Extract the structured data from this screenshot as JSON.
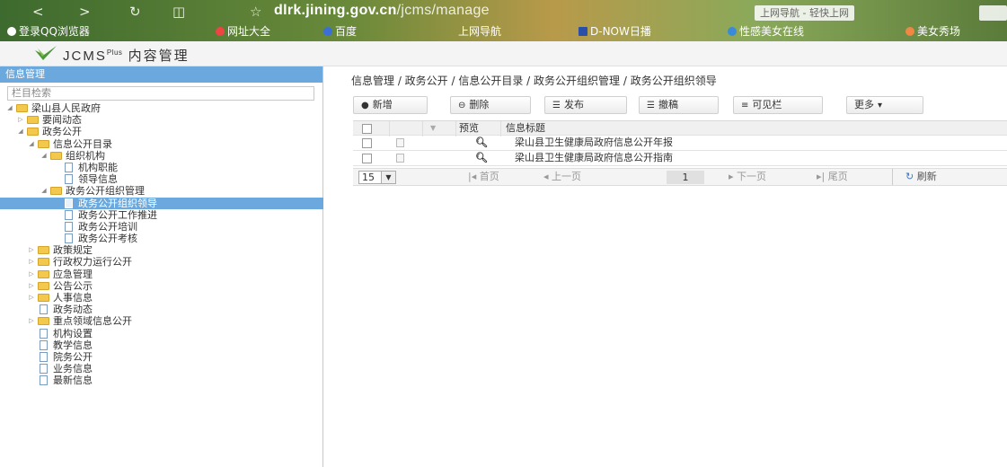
{
  "browser": {
    "url_host": "dlrk.jining.gov.cn",
    "url_path": "/jcms/manage",
    "tab_title": "上网导航 - 轻快上网",
    "bookmarks": [
      "登录QQ浏览器",
      "网址大全",
      "百度",
      "上网导航",
      "D-NOW日播",
      "性感美女在线",
      "美女秀场"
    ]
  },
  "app": {
    "title": "JCMS",
    "title_sup": "Plus",
    "title_suffix": "内容管理"
  },
  "left": {
    "header": "信息管理",
    "search_placeholder": "栏目检索",
    "tree": [
      {
        "label": "梁山县人民政府",
        "depth": 0,
        "kind": "folder",
        "arrow": "open"
      },
      {
        "label": "要闻动态",
        "depth": 1,
        "kind": "folder",
        "arrow": "closed"
      },
      {
        "label": "政务公开",
        "depth": 1,
        "kind": "folder",
        "arrow": "open"
      },
      {
        "label": "信息公开目录",
        "depth": 2,
        "kind": "folder",
        "arrow": "open"
      },
      {
        "label": "组织机构",
        "depth": 3,
        "kind": "folder",
        "arrow": "open"
      },
      {
        "label": "机构职能",
        "depth": 4,
        "kind": "page",
        "arrow": ""
      },
      {
        "label": "领导信息",
        "depth": 4,
        "kind": "page",
        "arrow": ""
      },
      {
        "label": "政务公开组织管理",
        "depth": 3,
        "kind": "folder",
        "arrow": "open"
      },
      {
        "label": "政务公开组织领导",
        "depth": 4,
        "kind": "page",
        "arrow": "",
        "selected": true
      },
      {
        "label": "政务公开工作推进",
        "depth": 4,
        "kind": "page",
        "arrow": ""
      },
      {
        "label": "政务公开培训",
        "depth": 4,
        "kind": "page",
        "arrow": ""
      },
      {
        "label": "政务公开考核",
        "depth": 4,
        "kind": "page",
        "arrow": ""
      },
      {
        "label": "政策规定",
        "depth": 2,
        "kind": "folder",
        "arrow": "closed"
      },
      {
        "label": "行政权力运行公开",
        "depth": 2,
        "kind": "folder",
        "arrow": "closed"
      },
      {
        "label": "应急管理",
        "depth": 2,
        "kind": "folder",
        "arrow": "closed"
      },
      {
        "label": "公告公示",
        "depth": 2,
        "kind": "folder",
        "arrow": "closed"
      },
      {
        "label": "人事信息",
        "depth": 2,
        "kind": "folder",
        "arrow": "closed"
      },
      {
        "label": "政务动态",
        "depth": 2,
        "kind": "page",
        "arrow": ""
      },
      {
        "label": "重点领域信息公开",
        "depth": 2,
        "kind": "folder",
        "arrow": "closed"
      },
      {
        "label": "机构设置",
        "depth": 2,
        "kind": "page",
        "arrow": ""
      },
      {
        "label": "教学信息",
        "depth": 2,
        "kind": "page",
        "arrow": ""
      },
      {
        "label": "院务公开",
        "depth": 2,
        "kind": "page",
        "arrow": ""
      },
      {
        "label": "业务信息",
        "depth": 2,
        "kind": "page",
        "arrow": ""
      },
      {
        "label": "最新信息",
        "depth": 2,
        "kind": "page",
        "arrow": ""
      }
    ]
  },
  "main": {
    "breadcrumb": "信息管理 / 政务公开 / 信息公开目录 / 政务公开组织管理 / 政务公开组织领导",
    "toolbar": {
      "add": "新增",
      "delete": "删除",
      "publish": "发布",
      "withdraw": "撤稿",
      "columns": "可见栏",
      "more": "更多"
    },
    "grid": {
      "col_preview": "预览",
      "col_title": "信息标题",
      "rows": [
        {
          "title": "梁山县卫生健康局政府信息公开年报"
        },
        {
          "title": "梁山县卫生健康局政府信息公开指南"
        }
      ]
    },
    "pager": {
      "page_size": "15",
      "first": "首页",
      "prev": "上一页",
      "page": "1",
      "next": "下一页",
      "last": "尾页",
      "refresh": "刷新"
    }
  }
}
